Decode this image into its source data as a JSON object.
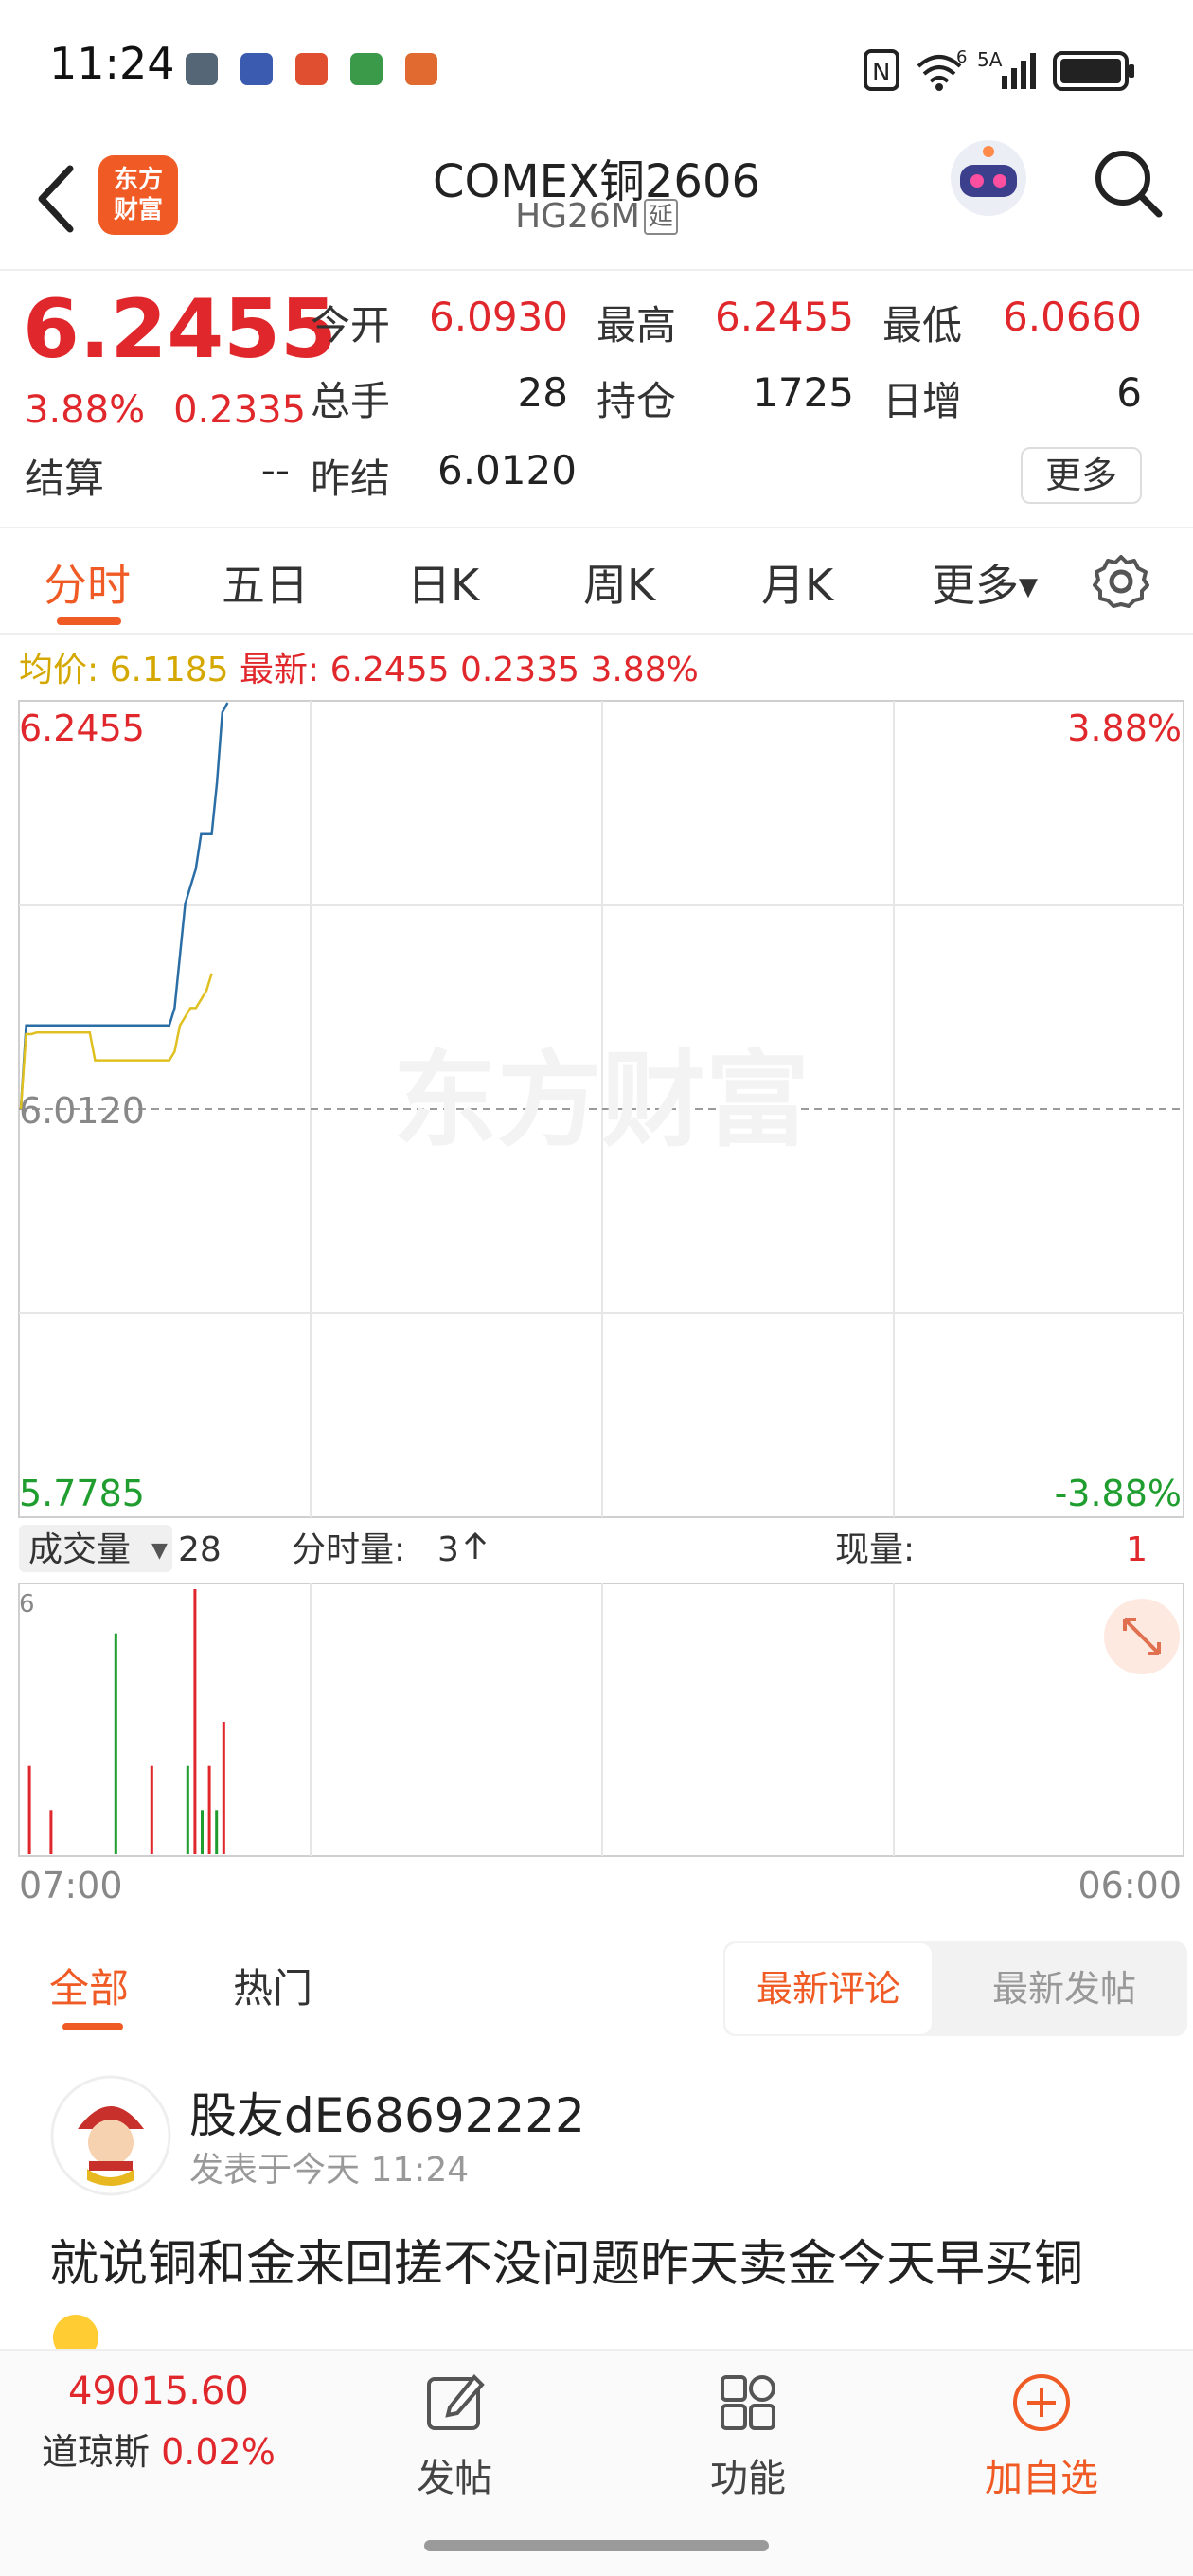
{
  "status_bar": {
    "time": "11:24",
    "signal_label_1": "6",
    "signal_label_2": "5A"
  },
  "header": {
    "app_logo_text": "东方\n财富",
    "title": "COMEX铜2606",
    "subtitle": "HG26M",
    "badge": "延"
  },
  "quote": {
    "price": "6.2455",
    "change_pct": "3.88%",
    "change_amt": "0.2335",
    "open_label": "今开",
    "open_value": "6.0930",
    "high_label": "最高",
    "high_value": "6.2455",
    "low_label": "最低",
    "low_value": "6.0660",
    "volume_label": "总手",
    "volume_value": "28",
    "position_label": "持仓",
    "position_value": "1725",
    "daily_inc_label": "日增",
    "daily_inc_value": "6",
    "settle_label": "结算",
    "settle_value": "--",
    "prev_settle_label": "昨结",
    "prev_settle_value": "6.0120",
    "more_button": "更多"
  },
  "chart_tabs": {
    "items": [
      "分时",
      "五日",
      "日K",
      "周K",
      "月K",
      "更多"
    ],
    "active": "分时"
  },
  "chart_info": {
    "avg_label": "均价:",
    "avg_value": "6.1185",
    "latest_label": "最新:",
    "latest_value": "6.2455",
    "latest_change": "0.2335",
    "latest_pct": "3.88%"
  },
  "chart_data": {
    "type": "line",
    "price_axis": {
      "top": "6.2455",
      "mid": "6.0120",
      "bottom": "5.7785",
      "ylim": [
        5.7785,
        6.2455
      ]
    },
    "pct_axis": {
      "top": "3.88%",
      "bottom": "-3.88%"
    },
    "watermark": "东方财富",
    "x_labels": {
      "start": "07:00",
      "end": "06:00"
    },
    "series": [
      {
        "color": "#2b6ea6",
        "values": [
          6.012,
          6.06,
          6.06,
          6.06,
          6.06,
          6.06,
          6.06,
          6.06,
          6.06,
          6.06,
          6.06,
          6.06,
          6.06,
          6.06,
          6.06,
          6.06,
          6.06,
          6.06,
          6.06,
          6.06,
          6.06,
          6.06,
          6.06,
          6.06,
          6.06,
          6.06,
          6.06,
          6.06,
          6.06,
          6.07,
          6.1,
          6.13,
          6.14,
          6.15,
          6.17,
          6.17,
          6.17,
          6.2,
          6.24,
          6.2455
        ]
      },
      {
        "color": "#e0c020",
        "values": [
          6.012,
          6.055,
          6.055,
          6.056,
          6.056,
          6.056,
          6.056,
          6.056,
          6.056,
          6.056,
          6.056,
          6.056,
          6.056,
          6.056,
          6.04,
          6.04,
          6.04,
          6.04,
          6.04,
          6.04,
          6.04,
          6.04,
          6.04,
          6.04,
          6.04,
          6.04,
          6.04,
          6.04,
          6.04,
          6.045,
          6.06,
          6.065,
          6.07,
          6.07,
          6.075,
          6.08,
          6.09
        ]
      }
    ],
    "volume_panel": {
      "selector": "成交量",
      "total": "28",
      "tick_label": "分时量:",
      "tick_value": "3",
      "current_label": "现量:",
      "current_value": "1",
      "ymax_label": "6",
      "bars": [
        {
          "i": 1,
          "v": 2,
          "c": "red"
        },
        {
          "i": 4,
          "v": 1,
          "c": "red"
        },
        {
          "i": 13,
          "v": 5,
          "c": "green"
        },
        {
          "i": 18,
          "v": 2,
          "c": "red"
        },
        {
          "i": 23,
          "v": 2,
          "c": "green"
        },
        {
          "i": 24,
          "v": 6,
          "c": "red"
        },
        {
          "i": 25,
          "v": 1,
          "c": "green"
        },
        {
          "i": 26,
          "v": 2,
          "c": "red"
        },
        {
          "i": 27,
          "v": 1,
          "c": "green"
        },
        {
          "i": 28,
          "v": 3,
          "c": "red"
        }
      ],
      "ylim": [
        0,
        6
      ]
    }
  },
  "comments": {
    "tabs": [
      "全部",
      "热门"
    ],
    "active_tab": "全部",
    "sort_options": [
      "最新评论",
      "最新发帖"
    ],
    "active_sort": "最新评论",
    "post": {
      "username": "股友dE68692222",
      "time": "发表于今天 11:24",
      "content": "就说铜和金来回搓不没问题昨天卖金今天早买铜"
    }
  },
  "bottom_nav": {
    "index_value": "49015.60",
    "index_name": "道琼斯",
    "index_pct": "0.02%",
    "post_label": "发帖",
    "function_label": "功能",
    "add_label": "加自选"
  },
  "colors": {
    "accent": "#f05a24",
    "up": "#e0282c",
    "down": "#1f9e2f",
    "price_line": "#2b6ea6",
    "avg_line": "#e0c020"
  }
}
